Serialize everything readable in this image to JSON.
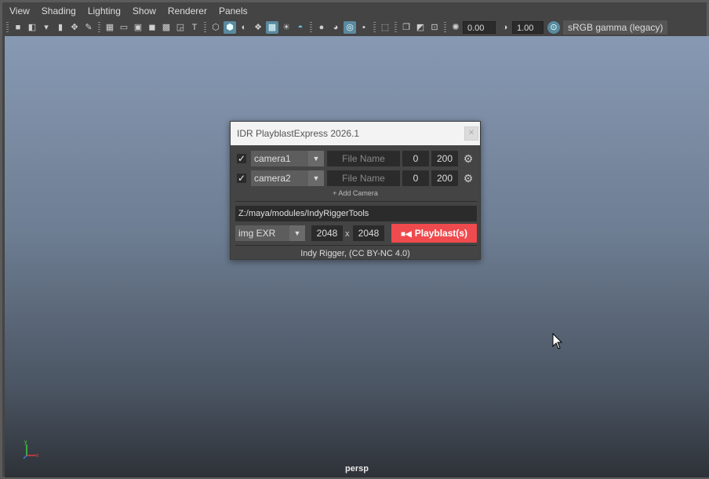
{
  "menubar": {
    "items": [
      "View",
      "Shading",
      "Lighting",
      "Show",
      "Renderer",
      "Panels"
    ]
  },
  "toolbar": {
    "exposure_value": "0.00",
    "gamma_value": "1.00",
    "color_space": "sRGB gamma (legacy)",
    "icons": [
      "camera-select-icon",
      "camera-attr-icon",
      "bookmark-icon",
      "image-plane-icon",
      "2d-pan-icon",
      "grease-pencil-icon",
      "grid-icon",
      "film-gate-icon",
      "resolution-gate-icon",
      "gate-mask-icon",
      "field-chart-icon",
      "safe-action-icon",
      "safe-title-icon",
      "wireframe-icon",
      "smooth-shade-icon",
      "default-material-icon",
      "textured-icon",
      "use-all-lights-icon",
      "shadows-icon",
      "screen-space-ao-icon",
      "motion-blur-icon",
      "anti-aliasing-icon",
      "depth-of-field-icon",
      "isolate-select-icon",
      "xray-icon",
      "xray-joints-icon",
      "backface-culling-icon",
      "exposure-icon",
      "gamma-icon",
      "color-management-icon"
    ]
  },
  "viewport": {
    "camera_label": "persp",
    "axis": {
      "y": "y",
      "x": "x"
    }
  },
  "dialog": {
    "title": "IDR PlayblastExpress 2026.1",
    "cameras": [
      {
        "enabled": true,
        "camera": "camera1",
        "file_name_placeholder": "File Name",
        "start": "0",
        "end": "200"
      },
      {
        "enabled": true,
        "camera": "camera2",
        "file_name_placeholder": "File Name",
        "start": "0",
        "end": "200"
      }
    ],
    "add_camera_label": "+ Add Camera",
    "output_path": "Z:/maya/modules/IndyRiggerTools",
    "format": "img EXR",
    "width": "2048",
    "height": "2048",
    "size_separator": "x",
    "playblast_label": "Playblast(s)",
    "credit": "Indy Rigger,  (CC BY-NC 4.0)",
    "check_mark": "✓",
    "colors": {
      "playblast": "#ef4a4d",
      "title_bar": "#f3f3f3"
    }
  }
}
